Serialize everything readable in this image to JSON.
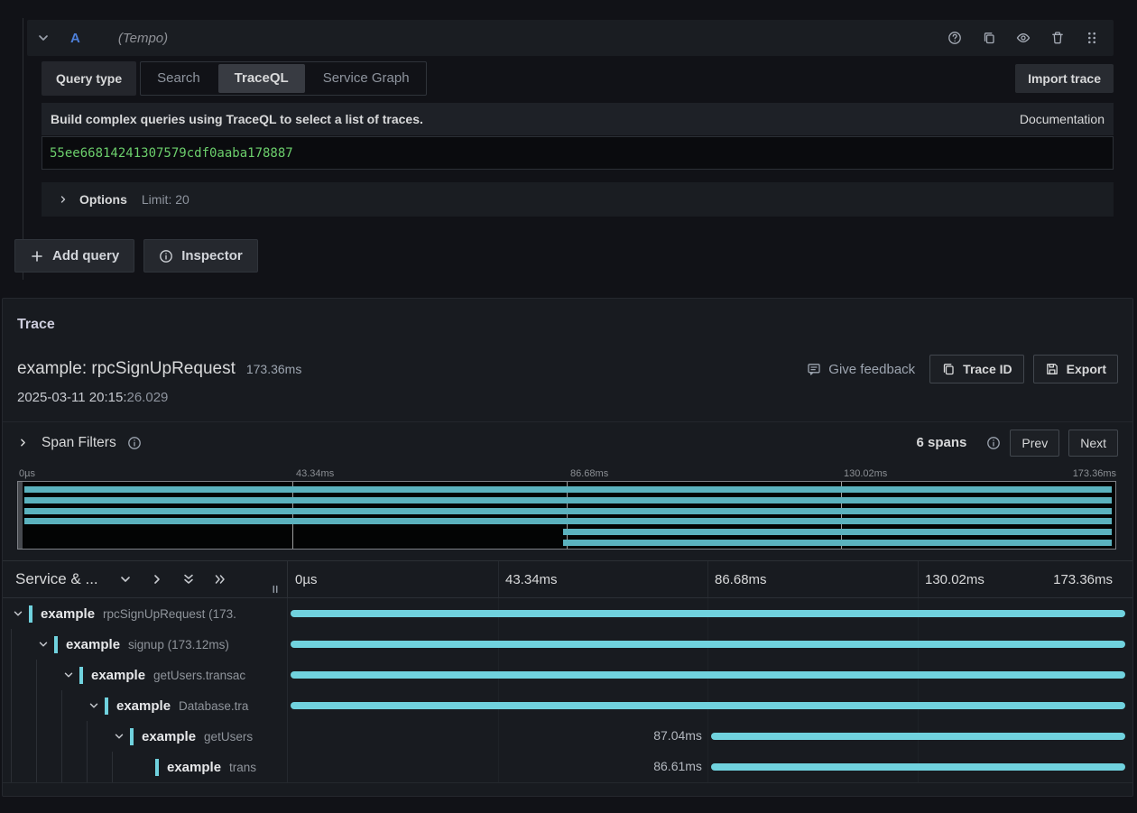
{
  "colors": {
    "accent_teal": "#70d2de",
    "minimap_teal": "#5bb2be",
    "query_green": "#6ccf6c",
    "ref_blue": "#4d7fd9",
    "panel_bg": "#181b20",
    "page_bg": "#111217"
  },
  "query_editor": {
    "ref_id": "A",
    "datasource_label": "(Tempo)",
    "query_type_label": "Query type",
    "tabs": [
      {
        "label": "Search",
        "active": false
      },
      {
        "label": "TraceQL",
        "active": true
      },
      {
        "label": "Service Graph",
        "active": false
      }
    ],
    "import_trace_label": "Import trace",
    "banner_text": "Build complex queries using TraceQL to select a list of traces.",
    "documentation_label": "Documentation",
    "query_value": "55ee66814241307579cdf0aaba178887",
    "options_label": "Options",
    "options_summary": "Limit: 20",
    "add_query_label": "Add query",
    "inspector_label": "Inspector"
  },
  "trace": {
    "panel_title": "Trace",
    "title": "example: rpcSignUpRequest",
    "duration": "173.36ms",
    "timestamp_prefix": "2025-03-11 20:15:",
    "timestamp_seconds": "26.029",
    "give_feedback_label": "Give feedback",
    "trace_id_label": "Trace ID",
    "export_label": "Export",
    "span_filters_label": "Span Filters",
    "span_count_label": "6 spans",
    "prev_label": "Prev",
    "next_label": "Next"
  },
  "timeline": {
    "header_title": "Service & ...",
    "ticks": [
      "0µs",
      "43.34ms",
      "86.68ms",
      "130.02ms",
      "173.36ms"
    ]
  },
  "minimap": {
    "bars": [
      {
        "start_pct": 0,
        "end_pct": 100
      },
      {
        "start_pct": 0,
        "end_pct": 100
      },
      {
        "start_pct": 0,
        "end_pct": 100
      },
      {
        "start_pct": 0,
        "end_pct": 100
      },
      {
        "start_pct": 49.7,
        "end_pct": 100
      },
      {
        "start_pct": 49.7,
        "end_pct": 100
      }
    ]
  },
  "spans": [
    {
      "service": "example",
      "operation": "rpcSignUpRequest (173.",
      "level": 0,
      "expandable": true,
      "duration_label": "",
      "bar_start_pct": 0,
      "bar_end_pct": 100
    },
    {
      "service": "example",
      "operation": "signup (173.12ms)",
      "level": 1,
      "expandable": true,
      "duration_label": "",
      "bar_start_pct": 0,
      "bar_end_pct": 100
    },
    {
      "service": "example",
      "operation": "getUsers.transac",
      "level": 2,
      "expandable": true,
      "duration_label": "",
      "bar_start_pct": 0,
      "bar_end_pct": 100
    },
    {
      "service": "example",
      "operation": "Database.tra",
      "level": 3,
      "expandable": true,
      "duration_label": "",
      "bar_start_pct": 0,
      "bar_end_pct": 100
    },
    {
      "service": "example",
      "operation": "getUsers",
      "level": 4,
      "expandable": true,
      "duration_label": "87.04ms",
      "bar_start_pct": 50.1,
      "bar_end_pct": 99.6
    },
    {
      "service": "example",
      "operation": "trans",
      "level": 5,
      "expandable": false,
      "duration_label": "86.61ms",
      "bar_start_pct": 50.1,
      "bar_end_pct": 99.6
    }
  ]
}
